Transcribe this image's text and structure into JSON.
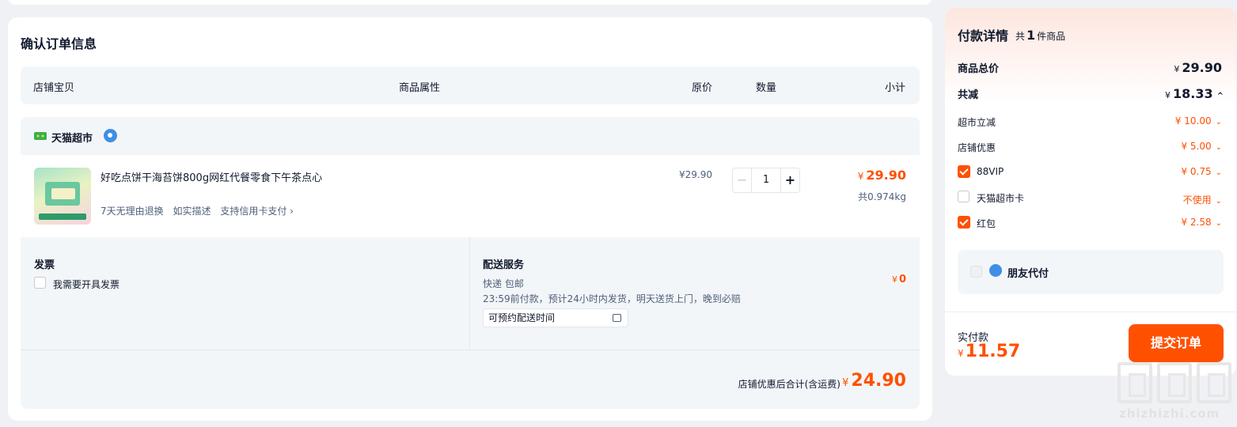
{
  "order": {
    "title": "确认订单信息",
    "columns": [
      "店铺宝贝",
      "商品属性",
      "原价",
      "数量",
      "小计"
    ]
  },
  "store": {
    "name": "天猫超市",
    "item": {
      "title": "好吃点饼干海苔饼800g网红代餐零食下午茶点心",
      "tags": [
        "7天无理由退换",
        "如实描述",
        "支持信用卡支付 ›"
      ],
      "unit_price": "¥29.90",
      "quantity": "1",
      "minus": "−",
      "plus": "+",
      "subtotal_yen": "¥",
      "subtotal": "29.90",
      "weight": "共0.974kg"
    },
    "invoice": {
      "title": "发票",
      "option": "我需要开具发票"
    },
    "delivery": {
      "title": "配送服务",
      "method": "快递 包邮",
      "note": "23:59前付款，预计24小时内发货，明天送货上门，晚到必赔",
      "schedule_placeholder": "可预约配送时间",
      "fee_yen": "¥",
      "fee": "0"
    },
    "footer": {
      "label": "店铺优惠后合计(含运费)",
      "total_yen": "¥",
      "total": "24.90"
    }
  },
  "payment": {
    "title": "付款详情",
    "count_prefix": "共",
    "count": "1",
    "count_suffix": "件商品",
    "goods_total_label": "商品总价",
    "goods_total": "29.90",
    "discount_label": "共减",
    "discount_total": "18.33",
    "discounts": [
      {
        "label": "超市立减",
        "value": "¥ 10.00"
      },
      {
        "label": "店铺优惠",
        "value": "¥ 5.00"
      },
      {
        "label": "88VIP",
        "value": "¥ 0.75",
        "checked": true
      },
      {
        "label": "天猫超市卡",
        "value": "不使用",
        "checked": false
      },
      {
        "label": "红包",
        "value": "¥ 2.58",
        "checked": true
      }
    ],
    "friend_pay": "朋友代付",
    "actual_label": "实付款",
    "actual_yen": "¥",
    "actual": "11.57",
    "submit": "提交订单",
    "yen": "¥",
    "chevron_down": "⌄",
    "chevron_up": "^"
  },
  "watermark": {
    "text": "zhizhizhi.com"
  },
  "colors": {
    "accent": "#ff5000",
    "panel_bg": "#f3f6f8",
    "page_bg": "#f0f1f4"
  }
}
